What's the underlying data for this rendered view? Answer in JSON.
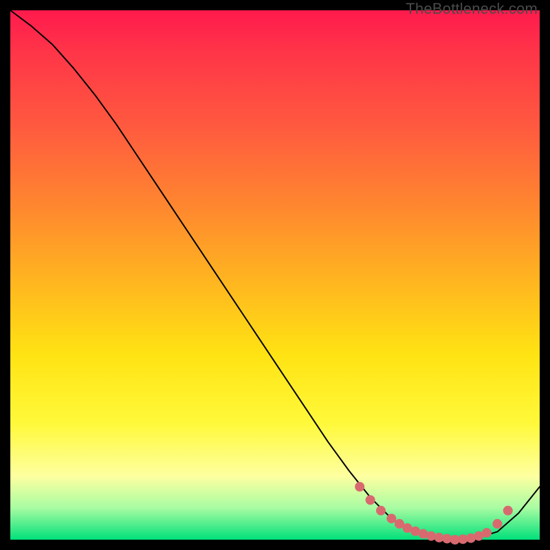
{
  "watermark": "TheBottleneck.com",
  "chart_data": {
    "type": "line",
    "title": "",
    "xlabel": "",
    "ylabel": "",
    "xlim": [
      0,
      100
    ],
    "ylim": [
      0,
      100
    ],
    "series": [
      {
        "name": "curve",
        "x": [
          0,
          4,
          8,
          12,
          16,
          20,
          24,
          28,
          32,
          36,
          40,
          44,
          48,
          52,
          56,
          60,
          64,
          68,
          72,
          76,
          80,
          84,
          88,
          92,
          96,
          100
        ],
        "y": [
          100,
          97,
          93.5,
          89,
          84,
          78.5,
          72.5,
          66.5,
          60.5,
          54.5,
          48.5,
          42.5,
          36.5,
          30.5,
          24.5,
          18.5,
          13,
          8,
          4,
          1.5,
          0.3,
          0,
          0.3,
          1.5,
          5,
          10
        ]
      }
    ],
    "markers": {
      "name": "highlight-points",
      "x": [
        66,
        68,
        70,
        72,
        73.5,
        75,
        76.5,
        78,
        79.5,
        81,
        82.5,
        84,
        85.5,
        87,
        88.5,
        90,
        92,
        94
      ],
      "y": [
        10,
        7.5,
        5.5,
        4,
        3,
        2.2,
        1.6,
        1.1,
        0.7,
        0.4,
        0.2,
        0,
        0.1,
        0.3,
        0.7,
        1.3,
        3.0,
        5.5
      ]
    }
  }
}
